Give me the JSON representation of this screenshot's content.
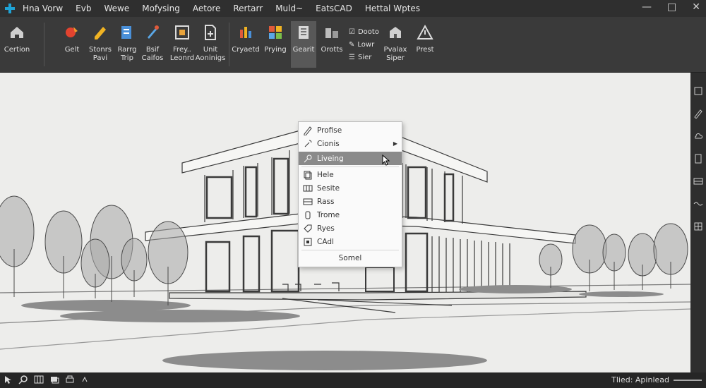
{
  "menu": [
    "Hna Vorw",
    "Evb",
    "Wewe",
    "Mofysing",
    "Aetore",
    "Rertarr",
    "Muld~",
    "EatsCAD",
    "Hettal Wptes"
  ],
  "window_controls": [
    "—",
    "□",
    "✕"
  ],
  "ribbon": {
    "items": [
      {
        "label": "Certion",
        "icon": "home-icon"
      },
      {
        "label": "Gelt",
        "icon": "paint-icon"
      },
      {
        "label": "Stonrs\nPavi",
        "icon": "pencil-icon"
      },
      {
        "label": "Rarrg\nTrip",
        "icon": "layers-icon"
      },
      {
        "label": "Bsif\nCaifos",
        "icon": "brush-icon"
      },
      {
        "label": "Frey..\nLeonrd",
        "icon": "crop-icon"
      },
      {
        "label": "Unit\nAoninigs",
        "icon": "page-add-icon"
      },
      {
        "label": "Cryaetd",
        "icon": "bars-icon"
      },
      {
        "label": "Prying",
        "icon": "color-grid-icon"
      },
      {
        "label": "Gearit",
        "icon": "list-icon"
      },
      {
        "label": "Orotts",
        "icon": "blocks-icon"
      },
      {
        "label": "Pvalax\nSiper",
        "icon": "building-icon"
      },
      {
        "label": "Prest",
        "icon": "warning-icon"
      }
    ],
    "stack": [
      "Dooto",
      "Lowr",
      "Sier"
    ]
  },
  "context_menu": {
    "items": [
      "Profise",
      "Cionis",
      "Liveing",
      "Hele",
      "Sesite",
      "Rass",
      "Trome",
      "Ryes",
      "CAdl"
    ],
    "cancel": "Somel"
  },
  "status": {
    "text": "Tlied: Apinlead"
  },
  "colors": {
    "highlight": "#8a8a8a",
    "accent": "#1fa3d6"
  }
}
